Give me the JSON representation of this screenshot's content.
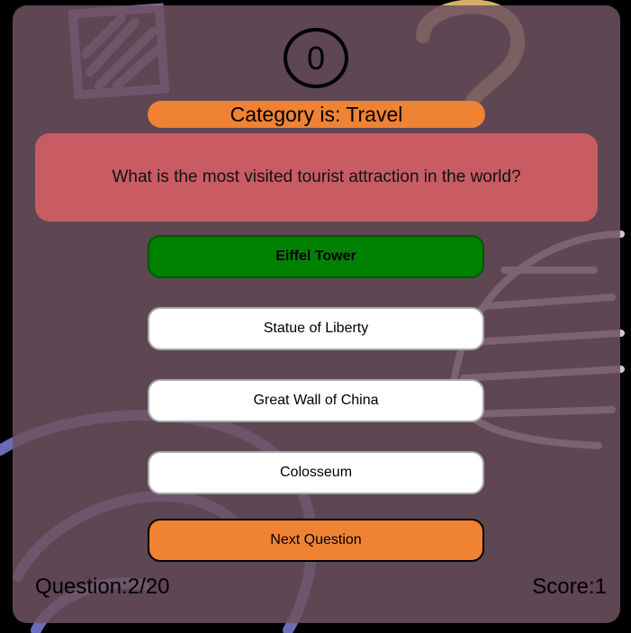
{
  "timer": {
    "value": "0"
  },
  "category": {
    "text": "Category is: Travel"
  },
  "question": {
    "text": "What is the most visited tourist attraction in the world?"
  },
  "answers": [
    {
      "label": "Eiffel Tower",
      "state": "correct"
    },
    {
      "label": "Statue of Liberty",
      "state": "default"
    },
    {
      "label": "Great Wall of China",
      "state": "default"
    },
    {
      "label": "Colosseum",
      "state": "default"
    }
  ],
  "next_button": {
    "label": "Next Question"
  },
  "footer": {
    "question_counter": "Question:2/20",
    "score": "Score:1"
  },
  "colors": {
    "card": "#6e5260",
    "category_pill": "#f08233",
    "question_box": "#c95c62",
    "correct_answer": "#008000",
    "next_button": "#f08233"
  }
}
